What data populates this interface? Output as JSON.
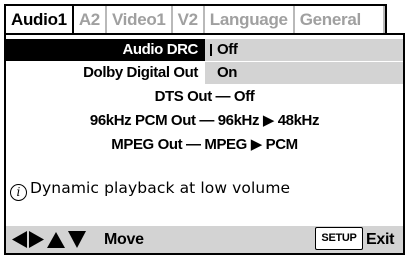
{
  "tabs": [
    {
      "label": "Audio1",
      "active": true
    },
    {
      "label": "A2",
      "active": false
    },
    {
      "label": "Video1",
      "active": false
    },
    {
      "label": "V2",
      "active": false
    },
    {
      "label": "Language",
      "active": false
    },
    {
      "label": "General",
      "active": false
    }
  ],
  "settings": {
    "audio_drc": {
      "label": "Audio DRC",
      "value": "Off"
    },
    "dolby_digital_out": {
      "label": "Dolby Digital Out",
      "value": "On"
    },
    "dts_out": "DTS Out — Off",
    "pcm_out": "96kHz PCM Out — 96kHz ▶ 48kHz",
    "mpeg_out": "MPEG Out — MPEG ▶ PCM"
  },
  "info": {
    "icon": "i",
    "text": "Dynamic playback at low volume"
  },
  "footer": {
    "move_label": "Move",
    "setup_label": "SETUP",
    "exit_label": "Exit"
  },
  "colors": {
    "highlight_bg": "#000000",
    "highlight_fg": "#ffffff",
    "value_bg": "#d3d3d3",
    "inactive_tab": "#a0a0a0"
  },
  "icons": [
    "left-arrow-icon",
    "right-arrow-icon",
    "up-arrow-icon",
    "down-arrow-icon",
    "info-icon"
  ]
}
